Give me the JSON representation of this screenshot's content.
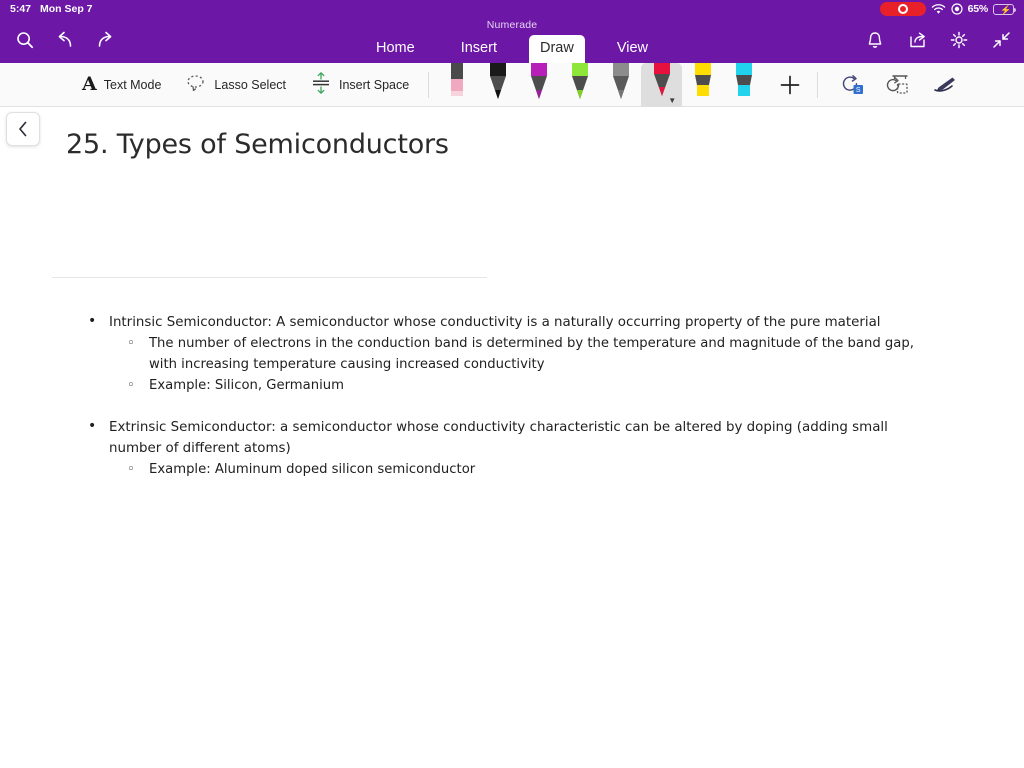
{
  "status_bar": {
    "time": "5:47",
    "date": "Mon Sep 7",
    "recording_label": "recording",
    "wifi_label": "wifi",
    "do_not_disturb_label": "focus",
    "battery_percent": "65%",
    "battery_level": 65,
    "battery_charging": true,
    "accent": "#6d17a6",
    "record_color": "#e8202a",
    "battery_color": "#35d04a"
  },
  "ribbon": {
    "document_title": "Numerade",
    "left_buttons": [
      {
        "name": "search-icon",
        "label": "Search"
      },
      {
        "name": "undo-icon",
        "label": "Undo"
      },
      {
        "name": "redo-icon",
        "label": "Redo"
      }
    ],
    "tabs": [
      {
        "label": "Home",
        "active": false
      },
      {
        "label": "Insert",
        "active": false
      },
      {
        "label": "Draw",
        "active": true
      },
      {
        "label": "View",
        "active": false
      }
    ],
    "right_buttons": [
      {
        "name": "bell-icon",
        "label": "Notifications"
      },
      {
        "name": "share-icon",
        "label": "Share"
      },
      {
        "name": "gear-icon",
        "label": "Settings"
      },
      {
        "name": "collapse-ribbon-icon",
        "label": "Collapse Ribbon"
      }
    ]
  },
  "toolbar": {
    "text_mode_label": "Text Mode",
    "lasso_select_label": "Lasso Select",
    "insert_space_label": "Insert Space",
    "add_pen_label": "+",
    "pens": [
      {
        "name": "eraser",
        "label": "Eraser",
        "color": "#f0a9c0",
        "type": "eraser",
        "selected": false
      },
      {
        "name": "pen-black",
        "label": "Pen Black",
        "color": "#1a1a1a",
        "type": "pen",
        "selected": false
      },
      {
        "name": "pen-purple",
        "label": "Pen Purple",
        "color": "#9b1f9b",
        "type": "pen",
        "selected": false
      },
      {
        "name": "pen-green",
        "label": "Pen Green",
        "color": "#7ed321",
        "type": "pen",
        "selected": false
      },
      {
        "name": "pen-gray",
        "label": "Pen Gray",
        "color": "#757575",
        "type": "pen",
        "selected": false
      },
      {
        "name": "pen-red",
        "label": "Pen Red",
        "color": "#e6123d",
        "type": "pen",
        "selected": true
      },
      {
        "name": "highlighter-yellow",
        "label": "Highlighter Yellow",
        "color": "#ffdd00",
        "type": "highlighter",
        "selected": false
      },
      {
        "name": "highlighter-cyan",
        "label": "Highlighter Cyan",
        "color": "#22d3ee",
        "type": "highlighter",
        "selected": false
      }
    ],
    "right_tools": [
      {
        "name": "ink-to-shape-icon",
        "label": "Ink to Shape"
      },
      {
        "name": "ink-replay-icon",
        "label": "Ink Replay"
      },
      {
        "name": "ink-eraser-icon",
        "label": "Ink Eraser"
      }
    ]
  },
  "canvas": {
    "back_button_label": "Back",
    "slide_title": "25. Types of Semiconductors",
    "content": {
      "group1": {
        "bullet": "Intrinsic Semiconductor: A semiconductor whose conductivity is a naturally occurring property of the pure material",
        "sub1": "The number of electrons in the conduction band is determined by the temperature and magnitude of the band gap, with increasing temperature causing increased conductivity",
        "sub2": "Example: Silicon, Germanium"
      },
      "group2": {
        "bullet": "Extrinsic Semiconductor: a semiconductor whose conductivity characteristic can be altered by doping (adding small number of different atoms)",
        "sub1": "Example: Aluminum doped silicon semiconductor"
      }
    }
  }
}
